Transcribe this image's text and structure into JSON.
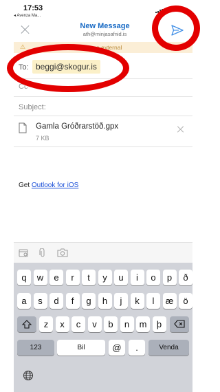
{
  "status_bar": {
    "time": "17:53",
    "back_app": "◂ Avenza Ma..."
  },
  "header": {
    "title": "New Message",
    "sender": "ath@minjasafnid.is"
  },
  "banner": {
    "text": "e external"
  },
  "to": {
    "label": "To:",
    "recipient": "beggi@skogur.is"
  },
  "cc": {
    "label": "Cc"
  },
  "subject": {
    "label": "Subject:"
  },
  "attachment": {
    "name": "Gamla Gróðrarstöð.gpx",
    "size": "7 KB"
  },
  "signature": {
    "prefix": "Get ",
    "link_text": "Outlook for iOS"
  },
  "keyboard": {
    "row1": [
      "q",
      "w",
      "e",
      "r",
      "t",
      "y",
      "u",
      "i",
      "o",
      "p",
      "ð"
    ],
    "row2": [
      "a",
      "s",
      "d",
      "f",
      "g",
      "h",
      "j",
      "k",
      "l",
      "æ",
      "ö"
    ],
    "row3": [
      "z",
      "x",
      "c",
      "v",
      "b",
      "n",
      "m",
      "þ"
    ],
    "numbers_key": "123",
    "space_key": "Bil",
    "at_key": "@",
    "dot_key": ".",
    "return_key": "Venda"
  },
  "colors": {
    "accent": "#1769c4",
    "annotation": "#e30000",
    "banner_bg": "#fbeed6",
    "chip_bg": "#fbf0c8"
  }
}
